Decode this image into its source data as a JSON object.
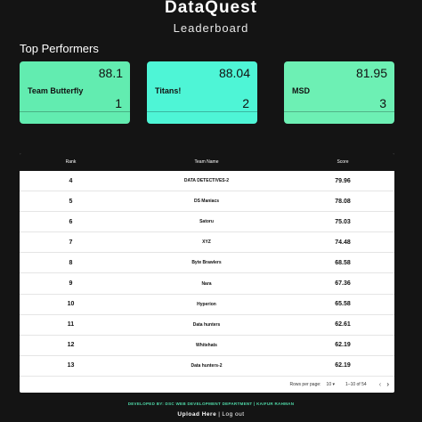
{
  "header": {
    "title": "DataQuest",
    "subtitle": "Leaderboard"
  },
  "top_performers": {
    "title": "Top Performers",
    "cards": [
      {
        "score": "88.1",
        "team": "Team Butterfly",
        "rank": "1",
        "color": "#62ecb0"
      },
      {
        "score": "88.04",
        "team": "Titans!",
        "rank": "2",
        "color": "#4ef5d6"
      },
      {
        "score": "81.95",
        "team": "MSD",
        "rank": "3",
        "color": "#6df0b4"
      }
    ]
  },
  "table": {
    "headers": {
      "rank": "Rank",
      "team": "Team Name",
      "score": "Score"
    },
    "rows": [
      {
        "rank": "4",
        "team": "DATA DETECTIVES-2",
        "score": "79.96"
      },
      {
        "rank": "5",
        "team": "DS Maniacs",
        "score": "78.08"
      },
      {
        "rank": "6",
        "team": "Satoru",
        "score": "75.03"
      },
      {
        "rank": "7",
        "team": "XYZ",
        "score": "74.48"
      },
      {
        "rank": "8",
        "team": "Byte Brawlers",
        "score": "68.58"
      },
      {
        "rank": "9",
        "team": "Nara",
        "score": "67.36"
      },
      {
        "rank": "10",
        "team": "Hyperion",
        "score": "65.58"
      },
      {
        "rank": "11",
        "team": "Data hunters",
        "score": "62.61"
      },
      {
        "rank": "12",
        "team": "Whitehats",
        "score": "62.19"
      },
      {
        "rank": "13",
        "team": "Data hunters-2",
        "score": "62.19"
      }
    ],
    "pagination": {
      "rows_per_page_label": "Rows per page:",
      "rows_per_page_value": "10",
      "range": "1–10 of 54",
      "prev_icon": "chevron-left-icon",
      "next_icon": "chevron-right-icon"
    }
  },
  "footer": {
    "credit": "DEVELOPED BY: DSC WEB DEVELOPMENT DEPARTMENT | KAIFUR RAHMAN",
    "upload": "Upload Here",
    "separator": "|",
    "logout": "Log out"
  },
  "colors": {
    "background": "#141414",
    "accent": "#4fd9a8"
  }
}
